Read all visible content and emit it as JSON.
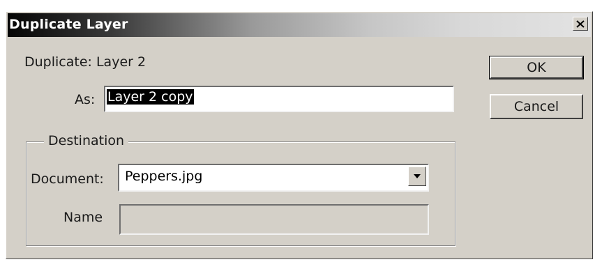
{
  "dialog": {
    "title": "Duplicate Layer",
    "close_icon": "close-icon"
  },
  "duplicate": {
    "label": "Duplicate:",
    "layer_name": "Layer 2"
  },
  "as_field": {
    "label": "As:",
    "value": "Layer 2 copy"
  },
  "buttons": {
    "ok_label": "OK",
    "cancel_label": "Cancel"
  },
  "destination": {
    "legend": "Destination",
    "document_label": "Document:",
    "document_value": "Peppers.jpg",
    "dropdown_icon": "chevron-down-icon",
    "name_label": "Name",
    "name_value": ""
  },
  "colors": {
    "dialog_bg": "#d4d0c8",
    "selection_bg": "#000000"
  }
}
